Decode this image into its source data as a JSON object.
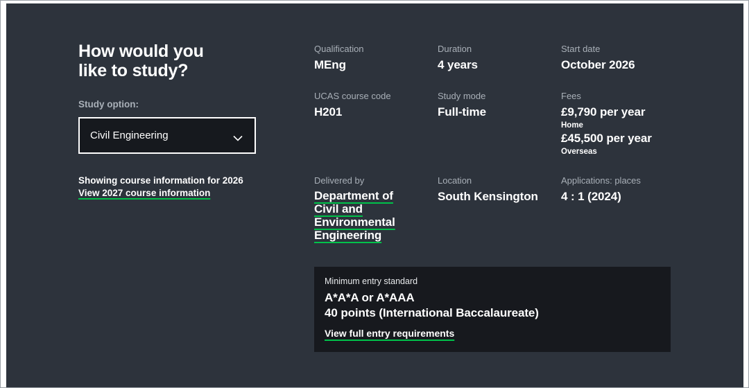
{
  "colors": {
    "panel_background": "#2d333c",
    "box_background": "#17191e",
    "accent_green": "#00c24a",
    "label_gray": "#a9b0b8",
    "text_white": "#ffffff"
  },
  "study_panel": {
    "heading": "How would you like to study?",
    "study_option_label": "Study option:",
    "study_option_value": "Civil Engineering",
    "showing_text": "Showing course information for 2026",
    "alt_year_link": "View 2027 course information"
  },
  "course_details": {
    "qualification": {
      "label": "Qualification",
      "value": "MEng"
    },
    "duration": {
      "label": "Duration",
      "value": "4 years"
    },
    "start_date": {
      "label": "Start date",
      "value": "October 2026"
    },
    "ucas_code": {
      "label": "UCAS course code",
      "value": "H201"
    },
    "study_mode": {
      "label": "Study mode",
      "value": "Full-time"
    },
    "fees": {
      "label": "Fees",
      "home_fee": "£9,790 per year",
      "home_note": "Home",
      "overseas_fee": "£45,500 per year",
      "overseas_note": "Overseas"
    },
    "delivered_by": {
      "label": "Delivered by",
      "link": "Department of Civil and Environmental Engineering"
    },
    "location": {
      "label": "Location",
      "value": "South Kensington"
    },
    "applications": {
      "label": "Applications: places",
      "value": "4 : 1 (2024)"
    }
  },
  "entry_requirements": {
    "label": "Minimum entry standard",
    "a_level": "A*A*A or A*AAA",
    "ib": "40 points (International Baccalaureate)",
    "link": "View full entry requirements"
  }
}
